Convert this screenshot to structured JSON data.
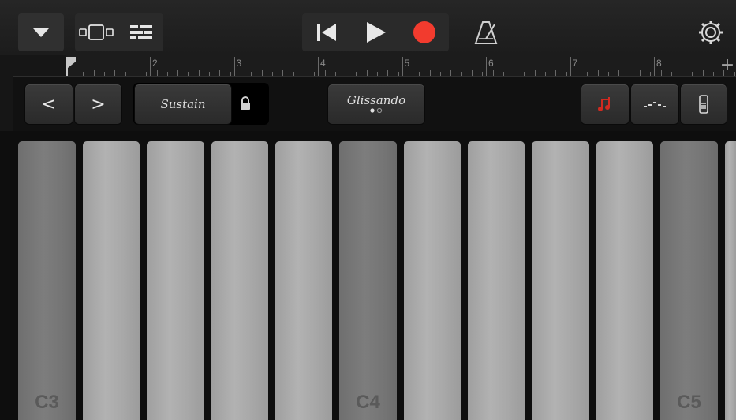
{
  "toolbar": {
    "icons": [
      "dropdown-icon",
      "keyboard-view-icon",
      "tracks-view-icon",
      "rewind-icon",
      "play-icon",
      "record-icon",
      "metronome-icon",
      "settings-icon"
    ],
    "record_color": "#f23b2e"
  },
  "ruler": {
    "bars": [
      "2",
      "3",
      "4",
      "5",
      "6",
      "7",
      "8"
    ],
    "add_label": "+"
  },
  "controls": {
    "prev_label": "<",
    "next_label": ">",
    "sustain_label": "Sustain",
    "glissando_label": "Glissando",
    "arpeggiator_color": "#d12a20"
  },
  "keyboard": {
    "labels": [
      "C3",
      "C4",
      "C5"
    ],
    "key_count": 12
  }
}
